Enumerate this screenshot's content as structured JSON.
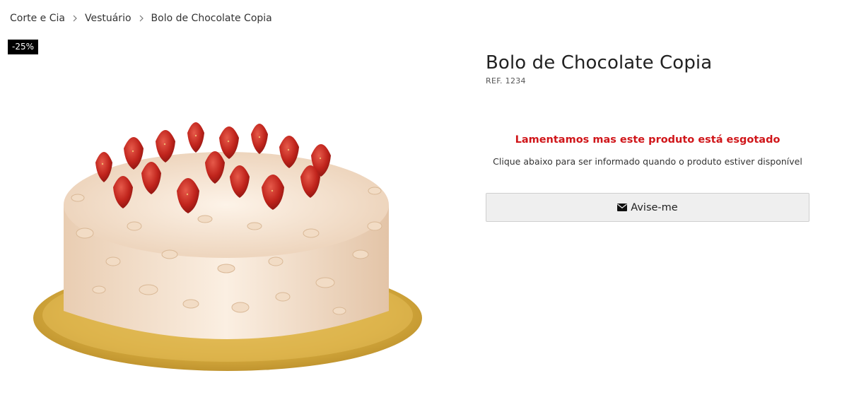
{
  "breadcrumb": {
    "items": [
      {
        "label": "Corte e Cia"
      },
      {
        "label": "Vestuário"
      },
      {
        "label": "Bolo de Chocolate Copia"
      }
    ]
  },
  "badge": {
    "label": "-25%"
  },
  "product": {
    "title": "Bolo de Chocolate Copia",
    "ref": "REF. 1234",
    "image_icon": "cake-image"
  },
  "availability": {
    "message": "Lamentamos mas este produto está esgotado",
    "hint": "Clique abaixo para ser informado quando o produto estiver disponível",
    "message_color": "#d0161a"
  },
  "notify": {
    "label": "Avise-me",
    "icon": "envelope-icon"
  }
}
